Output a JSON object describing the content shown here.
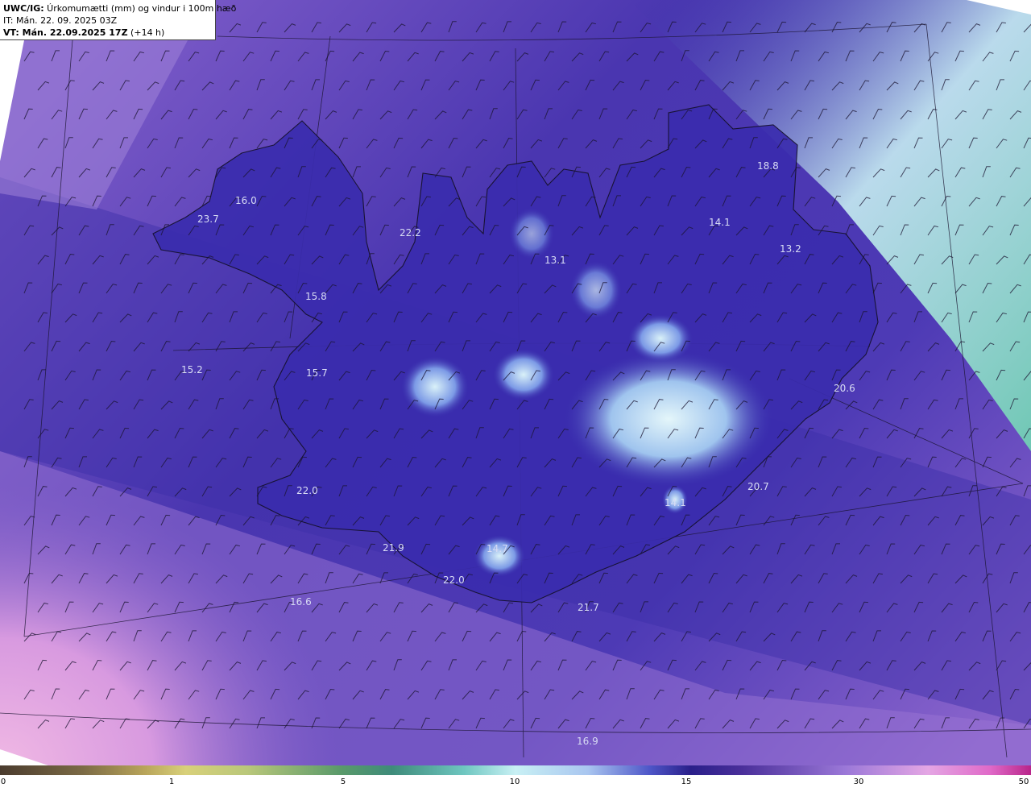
{
  "header": {
    "product_prefix": "UWC/IG:",
    "product_desc": " Úrkomumætti (mm) og vindur i 100m hæð",
    "issue_time": "IT: Mán. 22. 09. 2025 03Z",
    "valid_prefix": "VT: Mán. 22.09.2025 17Z",
    "valid_suffix": " (+14 h)"
  },
  "map_values": [
    {
      "id": "v1",
      "text": "16.0"
    },
    {
      "id": "v2",
      "text": "23.7"
    },
    {
      "id": "v3",
      "text": "22.2"
    },
    {
      "id": "v4",
      "text": "18.8"
    },
    {
      "id": "v5",
      "text": "14.1"
    },
    {
      "id": "v6",
      "text": "13.2"
    },
    {
      "id": "v7",
      "text": "13.1"
    },
    {
      "id": "v8",
      "text": "15.8"
    },
    {
      "id": "v9",
      "text": "15.2"
    },
    {
      "id": "v10",
      "text": "15.7"
    },
    {
      "id": "v11",
      "text": "20.6"
    },
    {
      "id": "v12",
      "text": "22.0"
    },
    {
      "id": "v13",
      "text": "20.7"
    },
    {
      "id": "v14",
      "text": "14.1"
    },
    {
      "id": "v15",
      "text": "21.9"
    },
    {
      "id": "v16",
      "text": "14.7"
    },
    {
      "id": "v17",
      "text": "22.0"
    },
    {
      "id": "v18",
      "text": "16.6"
    },
    {
      "id": "v19",
      "text": "21.7"
    },
    {
      "id": "v20",
      "text": "16.9"
    }
  ],
  "colorbar": {
    "ticks": [
      "0",
      "1",
      "5",
      "10",
      "15",
      "30",
      "50"
    ]
  },
  "colors": {
    "low_precip": "#7b58c8",
    "mid_precip": "#3a2fa6",
    "high_precip": "#c8f0f4",
    "land_outline": "#1a1430"
  }
}
